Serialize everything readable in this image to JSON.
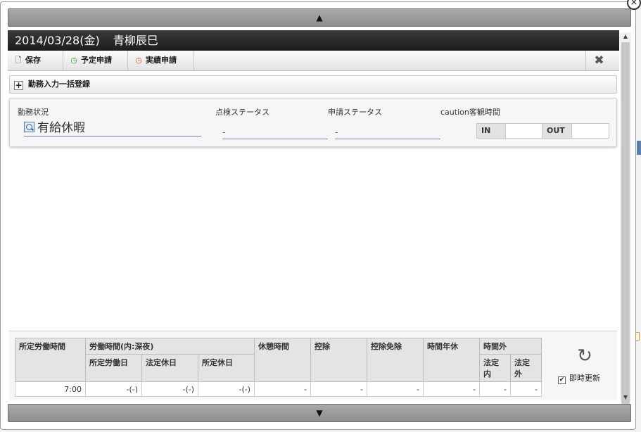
{
  "close_corner": "×",
  "scroll": {
    "up": "▲",
    "down": "▼"
  },
  "titlebar": {
    "date": "2014/03/28(金)",
    "name": "青柳辰巳"
  },
  "toolbar": {
    "save": "保存",
    "schedule_request": "予定申請",
    "actual_request": "実績申請",
    "close": "✖"
  },
  "bulk": {
    "plus": "+",
    "label": "勤務入力一括登録"
  },
  "status": {
    "work_status_label": "勤務状況",
    "work_status_value": "有給休暇",
    "check_status_label": "点検ステータス",
    "check_status_value": "-",
    "request_status_label": "申請ステータス",
    "request_status_value": "-",
    "caution_label": "caution客観時間",
    "in_label": "IN",
    "out_label": "OUT"
  },
  "totals": {
    "headers": {
      "scheduled_hours": "所定労働時間",
      "working_hours": "労働時間(内:深夜)",
      "scheduled_workday": "所定労働日",
      "legal_holiday": "法定休日",
      "scheduled_holiday": "所定休日",
      "break_time": "休憩時間",
      "deduction": "控除",
      "deduction_exempt": "控除免除",
      "hourly_leave": "時間年休",
      "overtime": "時間外",
      "overtime_legal_in": "法定\n内",
      "overtime_legal_out": "法定\n外"
    },
    "values": {
      "scheduled_hours": "7:00",
      "scheduled_workday": "-(-)",
      "legal_holiday": "-(-)",
      "scheduled_holiday": "-(-)",
      "break_time": "-",
      "deduction": "-",
      "deduction_exempt": "-",
      "hourly_leave": "-",
      "overtime_legal_in": "-",
      "overtime_legal_out": "-"
    },
    "refresh_icon": "↻",
    "realtime_label": "即時更新",
    "realtime_checked": "✔"
  }
}
